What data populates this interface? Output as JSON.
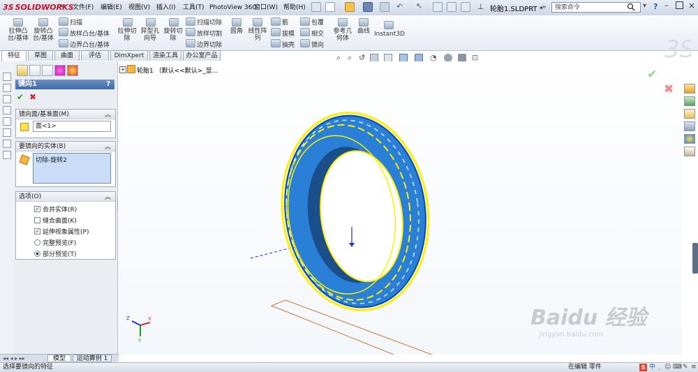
{
  "app": {
    "brand": "SOLIDWORKS",
    "brand_prefix": "3S"
  },
  "menu": [
    "文件(F)",
    "编辑(E)",
    "视图(V)",
    "插入(I)",
    "工具(T)",
    "PhotoView 360",
    "窗口(W)",
    "帮助(H)"
  ],
  "document_title": "轮胎1.SLDPRT *",
  "search": {
    "placeholder": "搜索命令"
  },
  "commands": {
    "extrude_boss": "拉伸凸台/基体",
    "revolve_boss": "旋转凸台/基体",
    "sweep": "扫描",
    "loft": "放样凸台/基体",
    "boundary_boss": "边界凸台/基体",
    "extrude_cut": "拉伸切除",
    "hole_wizard": "异型孔向导",
    "revolve_cut": "旋转切除",
    "swept_cut": "扫描切除",
    "lofted_cut": "放样切割",
    "boundary_cut": "边界切除",
    "fillet": "圆角",
    "linear_pattern": "线性阵列",
    "rib": "筋",
    "draft": "拔模",
    "shell": "抽壳",
    "wrap": "包覆",
    "intersect": "相交",
    "mirror": "镜向",
    "reference_geometry": "参考几何体",
    "curves": "曲线",
    "instant3d": "Instant3D"
  },
  "tabs": [
    "特征",
    "草图",
    "曲面",
    "评估",
    "DimXpert",
    "渲染工具",
    "办公室产品"
  ],
  "feature_tree": {
    "root": "轮胎1 （默认<<默认>_显..."
  },
  "property_manager": {
    "title": "镜向1",
    "help": "?",
    "mirror_face_group": {
      "title": "镜向面/基准面(M)",
      "value": "面<1>"
    },
    "bodies_group": {
      "title": "要镜向的实体(B)",
      "items": [
        "切除-旋转2"
      ]
    },
    "options_group": {
      "title": "选项(O)",
      "options": [
        {
          "label": "合并实体(R)",
          "checked": true
        },
        {
          "label": "缝合曲面(K)",
          "checked": false
        },
        {
          "label": "延伸视象属性(P)",
          "checked": true
        }
      ],
      "preview": [
        {
          "label": "完整预览(F)",
          "selected": false
        },
        {
          "label": "部分预览(T)",
          "selected": true
        }
      ]
    }
  },
  "bottom_tabs": [
    "模型",
    "运动算例 1"
  ],
  "status": {
    "left": "选择要镜向的特征",
    "right": "在编辑 零件"
  },
  "triad": {
    "x": "X",
    "y": "Y",
    "z": "Z"
  },
  "watermark": {
    "main": "Baidu 经验",
    "sub": "jingyan.baidu.com"
  },
  "colors": {
    "accent": "#3f6aa6",
    "tire_blue": "#2a7fd6",
    "preview_yellow": "#ffee00"
  }
}
